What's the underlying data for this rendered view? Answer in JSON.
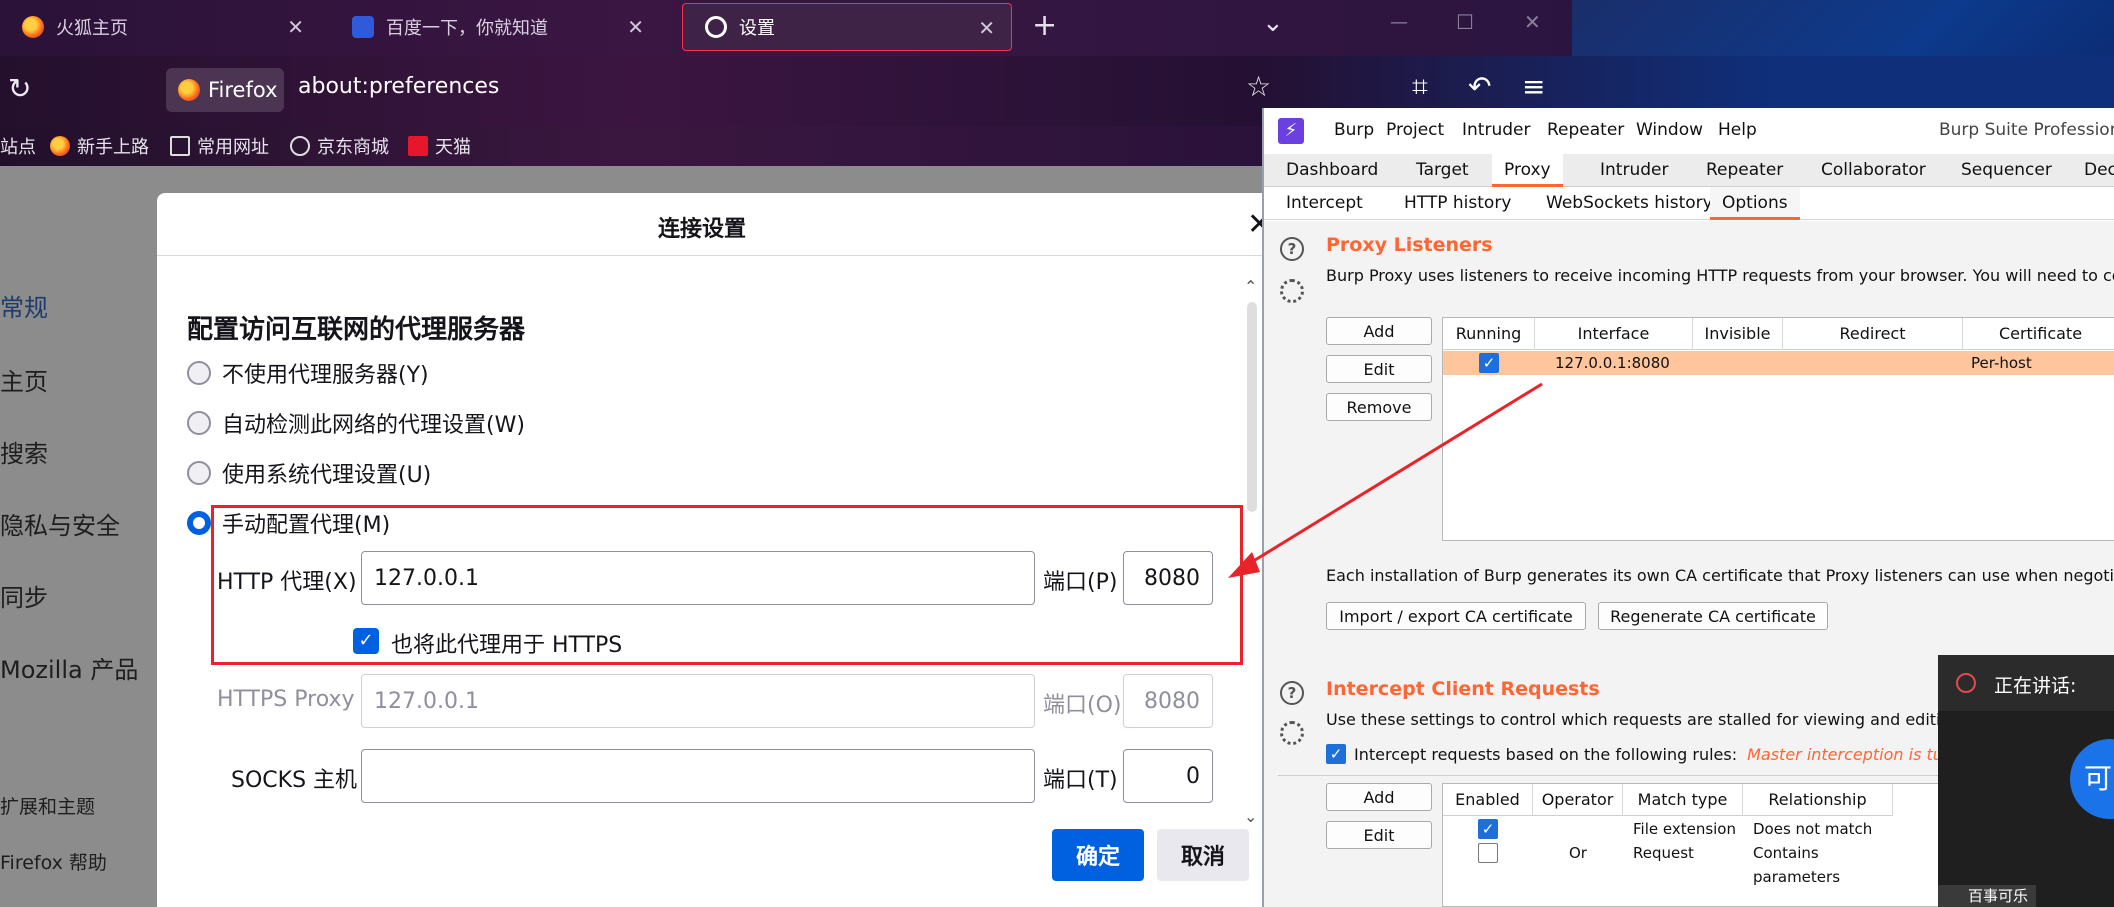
{
  "firefox": {
    "tabs": [
      {
        "label": "火狐主页",
        "close": "✕"
      },
      {
        "label": "百度一下，你就知道",
        "close": "✕"
      },
      {
        "label": "设置",
        "close": "✕"
      }
    ],
    "new_tab": "+",
    "tab_list": "⌄",
    "window_controls": {
      "minimize": "—",
      "maximize": "☐",
      "close": "✕"
    },
    "reload": "↻",
    "identity": "Firefox",
    "url": "about:preferences",
    "bookmarks": [
      "站点",
      "新手上路",
      "常用网址",
      "京东商城",
      "天猫"
    ],
    "sidebar": {
      "items": [
        "常规",
        "主页",
        "搜索",
        "隐私与安全",
        "同步",
        "Mozilla 产品"
      ],
      "footer": [
        "扩展和主题",
        "Firefox 帮助"
      ]
    }
  },
  "dialog": {
    "title": "连接设置",
    "close": "✕",
    "heading": "配置访问互联网的代理服务器",
    "options": [
      "不使用代理服务器(Y)",
      "自动检测此网络的代理设置(W)",
      "使用系统代理设置(U)",
      "手动配置代理(M)"
    ],
    "selected_option": "手动配置代理(M)",
    "http_label": "HTTP 代理(X)",
    "http_value": "127.0.0.1",
    "http_port_label": "端口(P)",
    "http_port": "8080",
    "https_checkbox_label": "也将此代理用于 HTTPS",
    "https_checkbox_checked": true,
    "https_label": "HTTPS Proxy",
    "https_value": "127.0.0.1",
    "https_port_label": "端口(O)",
    "https_port": "8080",
    "socks_label": "SOCKS 主机",
    "socks_value": "",
    "socks_port_label": "端口(T)",
    "socks_port": "0",
    "ok": "确定",
    "cancel": "取消"
  },
  "burp": {
    "menu": [
      "Burp",
      "Project",
      "Intruder",
      "Repeater",
      "Window",
      "Help"
    ],
    "title": "Burp Suite Professional v",
    "main_tabs": [
      "Dashboard",
      "Target",
      "Proxy",
      "Intruder",
      "Repeater",
      "Collaborator",
      "Sequencer",
      "Dec"
    ],
    "main_tab_selected": "Proxy",
    "sub_tabs": [
      "Intercept",
      "HTTP history",
      "WebSockets history",
      "Options"
    ],
    "sub_tab_selected": "Options",
    "listeners": {
      "title": "Proxy Listeners",
      "desc": "Burp Proxy uses listeners to receive incoming HTTP requests from your browser. You will need to configure y",
      "buttons": [
        "Add",
        "Edit",
        "Remove"
      ],
      "columns": [
        "Running",
        "Interface",
        "Invisible",
        "Redirect",
        "Certificate"
      ],
      "rows": [
        {
          "running": true,
          "interface": "127.0.0.1:8080",
          "invisible": "",
          "redirect": "",
          "certificate": "Per-host"
        }
      ],
      "ca_desc": "Each installation of Burp generates its own CA certificate that Proxy listeners can use when negotiating TLS co",
      "ca_buttons": [
        "Import / export CA certificate",
        "Regenerate CA certificate"
      ]
    },
    "intercept": {
      "title": "Intercept Client Requests",
      "desc": "Use these settings to control which requests are stalled for viewing and editing in th",
      "checkbox_label": "Intercept requests based on the following rules:",
      "checkbox_checked": true,
      "note": "Master interception is turned",
      "buttons": [
        "Add",
        "Edit"
      ],
      "columns": [
        "Enabled",
        "Operator",
        "Match type",
        "Relationship"
      ],
      "rows": [
        {
          "enabled": true,
          "operator": "",
          "match_type": "File extension",
          "relationship": "Does not match"
        },
        {
          "enabled": false,
          "operator": "Or",
          "match_type": "Request",
          "relationship": "Contains parameters"
        }
      ]
    },
    "accent": "#ff6633"
  },
  "meeting": {
    "speaking": "正在讲话:",
    "avatar_char": "可",
    "speaker": "百事可乐"
  },
  "annotation_color": "#e8242a"
}
